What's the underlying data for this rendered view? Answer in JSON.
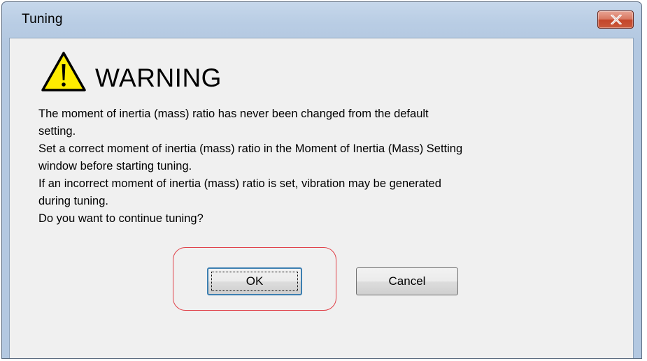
{
  "window": {
    "title": "Tuning"
  },
  "titlebar": {
    "close_icon": "close-x-icon"
  },
  "dialog": {
    "icon": "warning-triangle-icon",
    "heading": "WARNING",
    "message_lines": [
      "The moment of inertia (mass) ratio has never been changed from the default",
      "setting.",
      "Set a correct moment of inertia (mass) ratio in the Moment of Inertia (Mass) Setting",
      "window before starting tuning.",
      "If an incorrect moment of inertia (mass) ratio is set, vibration may be generated",
      "during tuning.",
      "Do you want to continue tuning?"
    ],
    "ok_label": "OK",
    "cancel_label": "Cancel"
  },
  "colors": {
    "highlight": "#e0424a",
    "warning_fill": "#ffec00",
    "close_button": "#c4452a"
  }
}
